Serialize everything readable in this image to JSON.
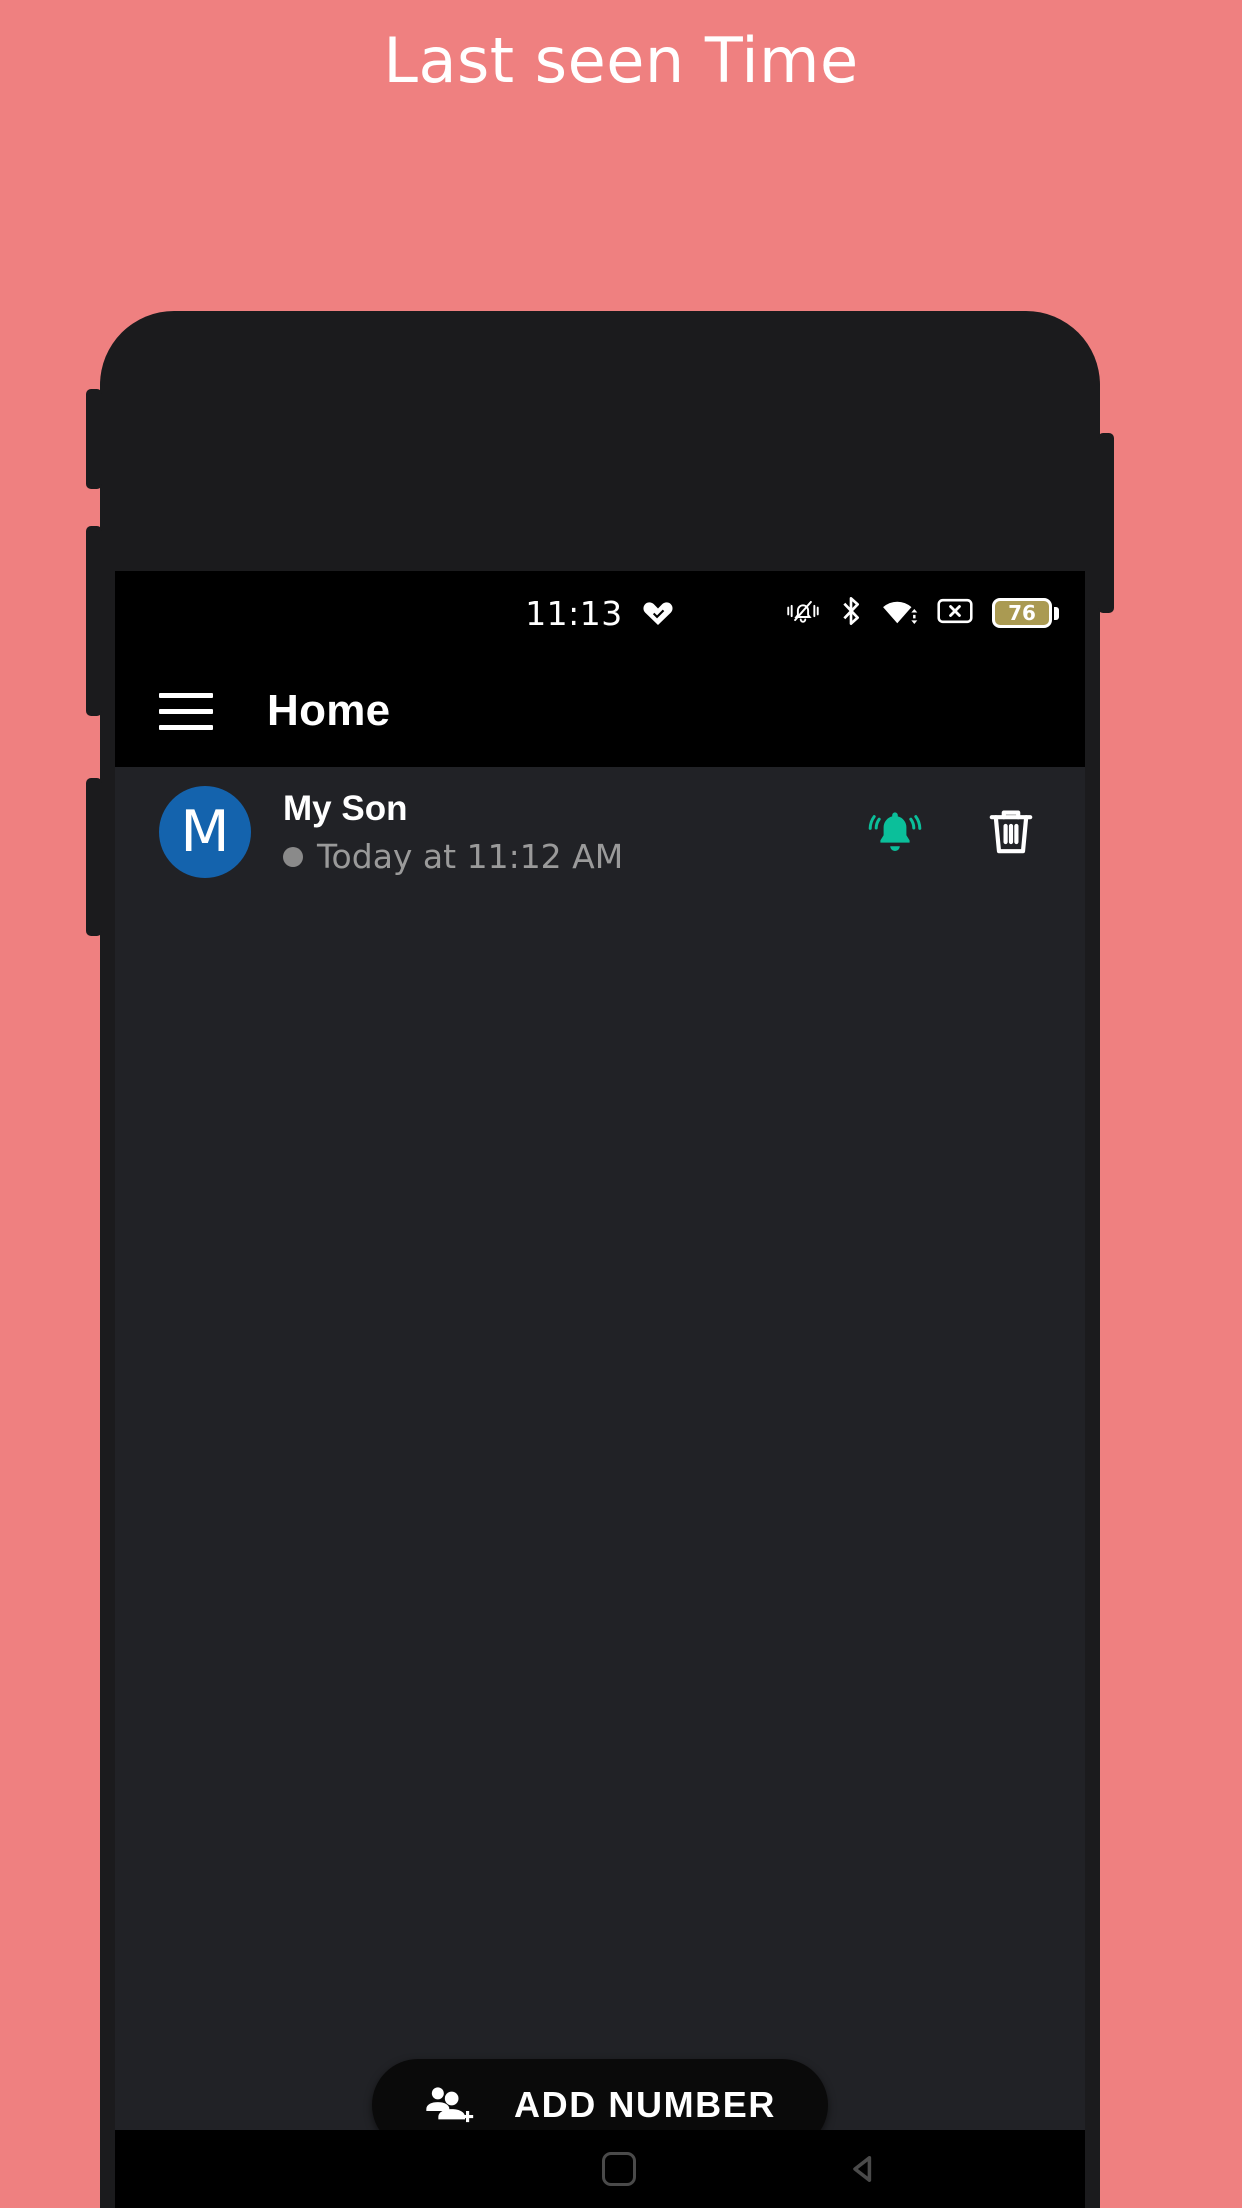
{
  "page": {
    "title": "Last seen Time",
    "background_color": "#ef8080",
    "title_color": "#ffffff"
  },
  "device": {
    "frame_color": "#1b1b1d",
    "screen_background": "#212226"
  },
  "status_bar": {
    "clock": "11:13",
    "health_icon": "heart-check-icon",
    "icons": [
      "vibrate-off-icon",
      "bluetooth-icon",
      "wifi-icon",
      "no-sim-icon"
    ],
    "battery_level": "76",
    "battery_color": "#aa9a52",
    "background": "#000000"
  },
  "app_bar": {
    "menu_icon": "hamburger-menu-icon",
    "title": "Home",
    "background": "#000000"
  },
  "list": {
    "items": [
      {
        "avatar_initial": "M",
        "avatar_color": "#1463ad",
        "name": "My Son",
        "status_dot_color": "#8a8a8a",
        "last_seen": "Today at 11:12 AM",
        "alarm_icon": "ringing-bell-icon",
        "alarm_icon_color": "#0bbf9a",
        "delete_icon": "trash-icon"
      }
    ]
  },
  "add_button": {
    "icon": "group-add-icon",
    "label": "ADD NUMBER",
    "background": "#0a0a0a"
  },
  "nav_bar": {
    "recents_icon": "recents-icon",
    "home_icon": "home-square-icon",
    "back_icon": "back-triangle-icon",
    "tint": "#4a4a4a"
  }
}
